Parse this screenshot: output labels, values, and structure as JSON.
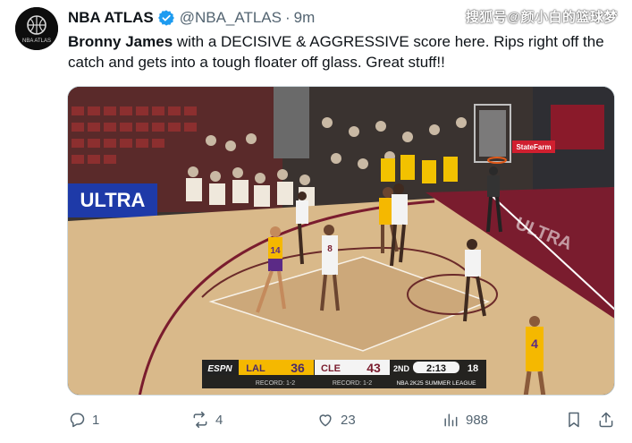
{
  "tweet": {
    "author_name": "NBA ATLAS",
    "author_handle": "@NBA_ATLAS",
    "separator": "·",
    "time": "9m",
    "avatar_text": "NBA ATLAS",
    "text_bold": "Bronny James",
    "text_rest": " with a DECISIVE & AGGRESSIVE score here. Rips right off the catch and gets into a tough floater off glass. Great stuff!!"
  },
  "watermark": "搜狐号@颜小白的篮球梦",
  "media": {
    "banner_left": "ULTRA",
    "banner_right": "StateFarm",
    "court_text": "ULTRA",
    "scorebug": {
      "network": "ESPN",
      "team1": "LAL",
      "score1": "36",
      "team2": "CLE",
      "score2": "43",
      "period": "2ND",
      "clock": "2:13",
      "shot_clock": "18",
      "record1": "RECORD: 1-2",
      "record2": "RECORD: 1-2",
      "event": "NBA 2K25 SUMMER LEAGUE"
    },
    "jerseys": [
      "14",
      "8",
      "4"
    ],
    "colors": {
      "lakers_gold": "#f5b800",
      "cavs_wine": "#7a1c2e",
      "court": "#d9b98a",
      "paint": "#b8333e"
    }
  },
  "actions": {
    "replies": "1",
    "reposts": "4",
    "likes": "23",
    "views": "988"
  },
  "icons": [
    "reply-icon",
    "repost-icon",
    "like-icon",
    "views-icon",
    "bookmark-icon",
    "share-icon",
    "verified-badge-icon"
  ]
}
